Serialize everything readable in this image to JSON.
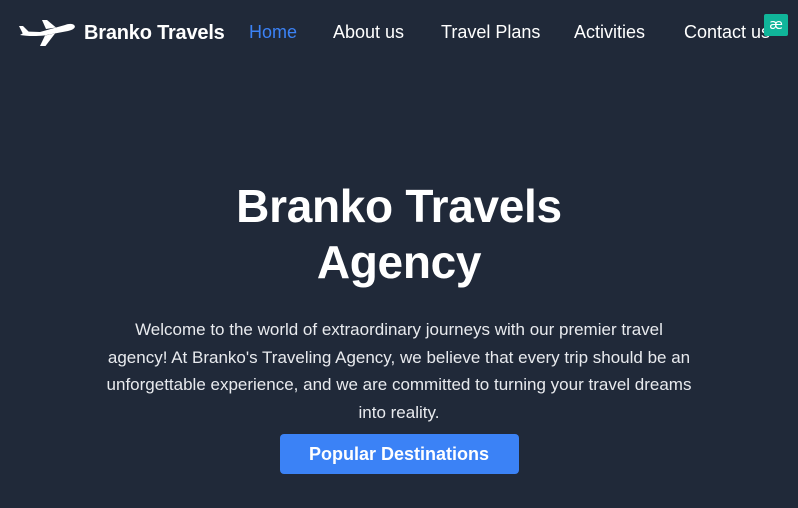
{
  "brand": {
    "name": "Branko Travels",
    "icon": "airplane-icon"
  },
  "nav": {
    "items": [
      {
        "label": "Home",
        "active": true
      },
      {
        "label": "About us",
        "active": false
      },
      {
        "label": "Travel Plans",
        "active": false
      },
      {
        "label": "Activities",
        "active": false
      },
      {
        "label": "Contact us",
        "active": false
      }
    ]
  },
  "extension_badge": {
    "label": "æ",
    "color": "#10b59a"
  },
  "hero": {
    "title_line1": "Branko Travels",
    "title_line2": "Agency",
    "description": "Welcome to the world of extraordinary journeys with our premier travel agency! At Branko's Traveling Agency, we believe that every trip should be an unforgettable experience, and we are committed to turning your travel dreams into reality.",
    "button_label": "Popular Destinations"
  },
  "colors": {
    "background": "#202939",
    "accent": "#3b82f6",
    "text": "#ffffff"
  }
}
